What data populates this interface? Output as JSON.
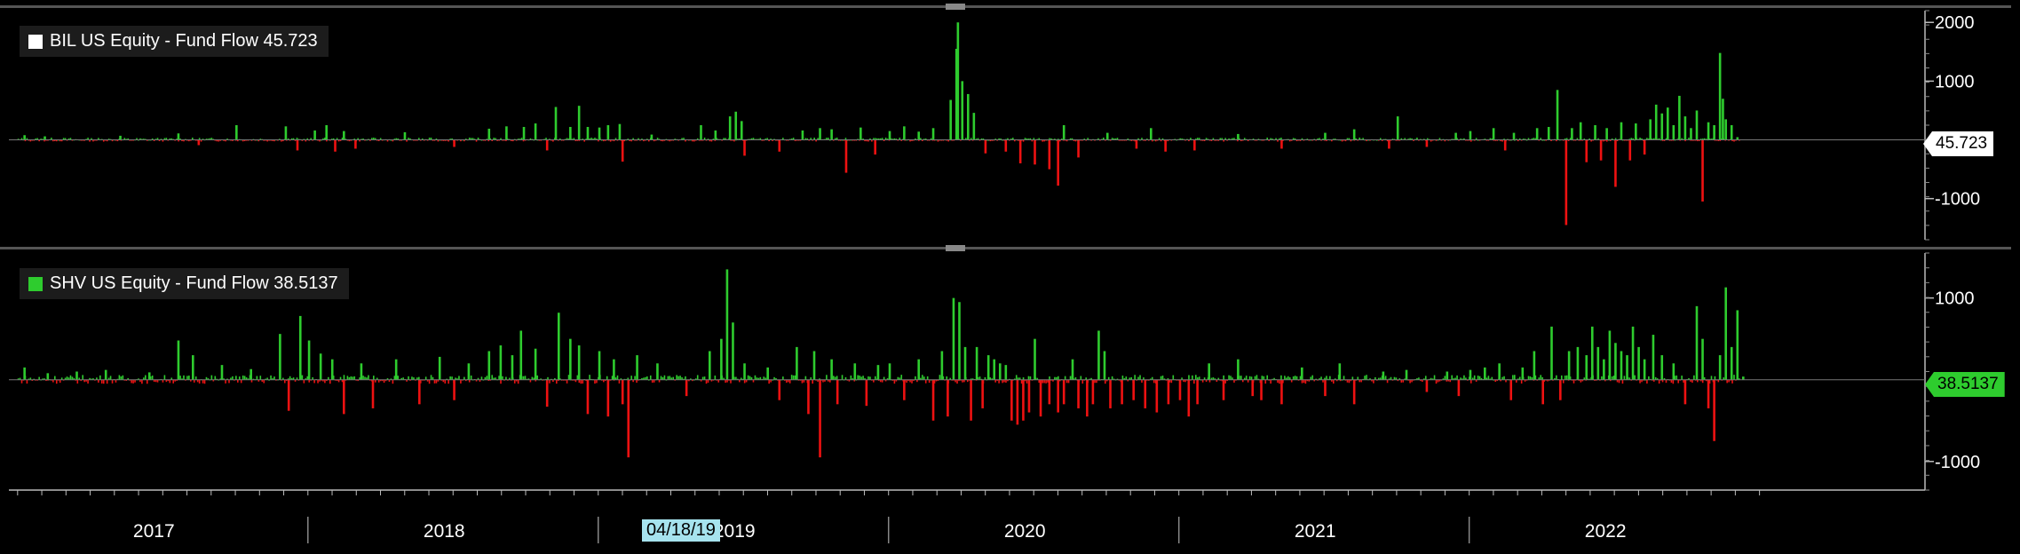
{
  "chart_data": [
    {
      "type": "bar",
      "name": "BIL",
      "legend": "BIL US Equity - Fund Flow 45.723",
      "legend_color": "#ffffff",
      "last_value": "45.723",
      "ylim": [
        -1700,
        2200
      ],
      "yticks": [
        2000,
        1000,
        -1000
      ],
      "pos_color": "#2ecc2e",
      "neg_color": "#ee1111",
      "spikes": [
        {
          "date": 2017.02,
          "value": 80
        },
        {
          "date": 2017.09,
          "value": 60
        },
        {
          "date": 2017.35,
          "value": 70
        },
        {
          "date": 2017.55,
          "value": 110
        },
        {
          "date": 2017.62,
          "value": -90
        },
        {
          "date": 2017.75,
          "value": 250
        },
        {
          "date": 2017.92,
          "value": 230
        },
        {
          "date": 2017.96,
          "value": -180
        },
        {
          "date": 2018.02,
          "value": 160
        },
        {
          "date": 2018.06,
          "value": 250
        },
        {
          "date": 2018.09,
          "value": -200
        },
        {
          "date": 2018.12,
          "value": 150
        },
        {
          "date": 2018.16,
          "value": -150
        },
        {
          "date": 2018.33,
          "value": 130
        },
        {
          "date": 2018.5,
          "value": -120
        },
        {
          "date": 2018.62,
          "value": 190
        },
        {
          "date": 2018.68,
          "value": 230
        },
        {
          "date": 2018.74,
          "value": 220
        },
        {
          "date": 2018.78,
          "value": 280
        },
        {
          "date": 2018.82,
          "value": -180
        },
        {
          "date": 2018.85,
          "value": 560
        },
        {
          "date": 2018.9,
          "value": 220
        },
        {
          "date": 2018.93,
          "value": 580
        },
        {
          "date": 2018.96,
          "value": 220
        },
        {
          "date": 2019.0,
          "value": 210
        },
        {
          "date": 2019.03,
          "value": 250
        },
        {
          "date": 2019.07,
          "value": 270
        },
        {
          "date": 2019.08,
          "value": -370
        },
        {
          "date": 2019.18,
          "value": 90
        },
        {
          "date": 2019.35,
          "value": 250
        },
        {
          "date": 2019.4,
          "value": 160
        },
        {
          "date": 2019.45,
          "value": 400
        },
        {
          "date": 2019.47,
          "value": 480
        },
        {
          "date": 2019.49,
          "value": 320
        },
        {
          "date": 2019.5,
          "value": -270
        },
        {
          "date": 2019.62,
          "value": -200
        },
        {
          "date": 2019.7,
          "value": 160
        },
        {
          "date": 2019.76,
          "value": 200
        },
        {
          "date": 2019.8,
          "value": 180
        },
        {
          "date": 2019.85,
          "value": -560
        },
        {
          "date": 2019.9,
          "value": 210
        },
        {
          "date": 2019.95,
          "value": -250
        },
        {
          "date": 2020.0,
          "value": 150
        },
        {
          "date": 2020.05,
          "value": 230
        },
        {
          "date": 2020.1,
          "value": 140
        },
        {
          "date": 2020.15,
          "value": 200
        },
        {
          "date": 2020.21,
          "value": 680
        },
        {
          "date": 2020.23,
          "value": 1550
        },
        {
          "date": 2020.235,
          "value": 2000
        },
        {
          "date": 2020.25,
          "value": 1000
        },
        {
          "date": 2020.27,
          "value": 780
        },
        {
          "date": 2020.29,
          "value": 460
        },
        {
          "date": 2020.33,
          "value": -230
        },
        {
          "date": 2020.4,
          "value": -200
        },
        {
          "date": 2020.45,
          "value": -400
        },
        {
          "date": 2020.5,
          "value": -420
        },
        {
          "date": 2020.55,
          "value": -500
        },
        {
          "date": 2020.58,
          "value": -780
        },
        {
          "date": 2020.6,
          "value": 250
        },
        {
          "date": 2020.65,
          "value": -300
        },
        {
          "date": 2020.75,
          "value": 120
        },
        {
          "date": 2020.85,
          "value": -150
        },
        {
          "date": 2020.9,
          "value": 200
        },
        {
          "date": 2020.95,
          "value": -200
        },
        {
          "date": 2021.05,
          "value": -180
        },
        {
          "date": 2021.2,
          "value": 100
        },
        {
          "date": 2021.35,
          "value": -150
        },
        {
          "date": 2021.5,
          "value": 120
        },
        {
          "date": 2021.6,
          "value": 180
        },
        {
          "date": 2021.72,
          "value": -150
        },
        {
          "date": 2021.75,
          "value": 400
        },
        {
          "date": 2021.85,
          "value": -120
        },
        {
          "date": 2021.95,
          "value": 120
        },
        {
          "date": 2022.0,
          "value": 150
        },
        {
          "date": 2022.08,
          "value": 200
        },
        {
          "date": 2022.12,
          "value": -180
        },
        {
          "date": 2022.15,
          "value": 120
        },
        {
          "date": 2022.23,
          "value": 200
        },
        {
          "date": 2022.27,
          "value": 220
        },
        {
          "date": 2022.3,
          "value": 850
        },
        {
          "date": 2022.33,
          "value": -1450
        },
        {
          "date": 2022.35,
          "value": 200
        },
        {
          "date": 2022.38,
          "value": 300
        },
        {
          "date": 2022.4,
          "value": -380
        },
        {
          "date": 2022.43,
          "value": 250
        },
        {
          "date": 2022.45,
          "value": -350
        },
        {
          "date": 2022.47,
          "value": 200
        },
        {
          "date": 2022.5,
          "value": -800
        },
        {
          "date": 2022.52,
          "value": 300
        },
        {
          "date": 2022.55,
          "value": -350
        },
        {
          "date": 2022.57,
          "value": 280
        },
        {
          "date": 2022.6,
          "value": -250
        },
        {
          "date": 2022.62,
          "value": 350
        },
        {
          "date": 2022.64,
          "value": 600
        },
        {
          "date": 2022.66,
          "value": 450
        },
        {
          "date": 2022.68,
          "value": 550
        },
        {
          "date": 2022.7,
          "value": 250
        },
        {
          "date": 2022.72,
          "value": 750
        },
        {
          "date": 2022.74,
          "value": 400
        },
        {
          "date": 2022.76,
          "value": 200
        },
        {
          "date": 2022.78,
          "value": 500
        },
        {
          "date": 2022.8,
          "value": -1050
        },
        {
          "date": 2022.82,
          "value": 300
        },
        {
          "date": 2022.84,
          "value": 250
        },
        {
          "date": 2022.86,
          "value": 1480
        },
        {
          "date": 2022.87,
          "value": 700
        },
        {
          "date": 2022.88,
          "value": 350
        },
        {
          "date": 2022.9,
          "value": 250
        },
        {
          "date": 2022.92,
          "value": 46
        }
      ]
    },
    {
      "type": "bar",
      "name": "SHV",
      "legend": "SHV US Equity - Fund Flow 38.5137",
      "legend_color": "#2ecc2e",
      "last_value": "38.5137",
      "ylim": [
        -1350,
        1550
      ],
      "yticks": [
        1000,
        -1000
      ],
      "pos_color": "#2ecc2e",
      "neg_color": "#ee1111",
      "spikes": [
        {
          "date": 2017.02,
          "value": 150
        },
        {
          "date": 2017.1,
          "value": 80
        },
        {
          "date": 2017.2,
          "value": 100
        },
        {
          "date": 2017.3,
          "value": 120
        },
        {
          "date": 2017.45,
          "value": 90
        },
        {
          "date": 2017.55,
          "value": 480
        },
        {
          "date": 2017.6,
          "value": 300
        },
        {
          "date": 2017.7,
          "value": 180
        },
        {
          "date": 2017.8,
          "value": 130
        },
        {
          "date": 2017.9,
          "value": 560
        },
        {
          "date": 2017.93,
          "value": -380
        },
        {
          "date": 2017.97,
          "value": 780
        },
        {
          "date": 2018.0,
          "value": 480
        },
        {
          "date": 2018.04,
          "value": 320
        },
        {
          "date": 2018.08,
          "value": 250
        },
        {
          "date": 2018.12,
          "value": -420
        },
        {
          "date": 2018.18,
          "value": 200
        },
        {
          "date": 2018.22,
          "value": -350
        },
        {
          "date": 2018.3,
          "value": 250
        },
        {
          "date": 2018.38,
          "value": -300
        },
        {
          "date": 2018.45,
          "value": 280
        },
        {
          "date": 2018.5,
          "value": -250
        },
        {
          "date": 2018.55,
          "value": 200
        },
        {
          "date": 2018.62,
          "value": 350
        },
        {
          "date": 2018.66,
          "value": 420
        },
        {
          "date": 2018.7,
          "value": 300
        },
        {
          "date": 2018.73,
          "value": 600
        },
        {
          "date": 2018.78,
          "value": 380
        },
        {
          "date": 2018.82,
          "value": -330
        },
        {
          "date": 2018.86,
          "value": 820
        },
        {
          "date": 2018.9,
          "value": 500
        },
        {
          "date": 2018.93,
          "value": 420
        },
        {
          "date": 2018.96,
          "value": -420
        },
        {
          "date": 2019.0,
          "value": 350
        },
        {
          "date": 2019.03,
          "value": -450
        },
        {
          "date": 2019.05,
          "value": 250
        },
        {
          "date": 2019.08,
          "value": -300
        },
        {
          "date": 2019.1,
          "value": -950
        },
        {
          "date": 2019.13,
          "value": 300
        },
        {
          "date": 2019.2,
          "value": 200
        },
        {
          "date": 2019.3,
          "value": -200
        },
        {
          "date": 2019.38,
          "value": 350
        },
        {
          "date": 2019.42,
          "value": 500
        },
        {
          "date": 2019.44,
          "value": 1350
        },
        {
          "date": 2019.46,
          "value": 700
        },
        {
          "date": 2019.5,
          "value": 200
        },
        {
          "date": 2019.58,
          "value": 150
        },
        {
          "date": 2019.62,
          "value": -250
        },
        {
          "date": 2019.68,
          "value": 400
        },
        {
          "date": 2019.72,
          "value": -420
        },
        {
          "date": 2019.74,
          "value": 350
        },
        {
          "date": 2019.76,
          "value": -950
        },
        {
          "date": 2019.8,
          "value": 250
        },
        {
          "date": 2019.82,
          "value": -300
        },
        {
          "date": 2019.88,
          "value": 200
        },
        {
          "date": 2019.92,
          "value": -320
        },
        {
          "date": 2019.96,
          "value": 180
        },
        {
          "date": 2020.0,
          "value": 200
        },
        {
          "date": 2020.05,
          "value": -250
        },
        {
          "date": 2020.1,
          "value": 250
        },
        {
          "date": 2020.15,
          "value": -500
        },
        {
          "date": 2020.18,
          "value": 350
        },
        {
          "date": 2020.2,
          "value": -450
        },
        {
          "date": 2020.22,
          "value": 1000
        },
        {
          "date": 2020.24,
          "value": 950
        },
        {
          "date": 2020.26,
          "value": 400
        },
        {
          "date": 2020.28,
          "value": -500
        },
        {
          "date": 2020.3,
          "value": 400
        },
        {
          "date": 2020.32,
          "value": -350
        },
        {
          "date": 2020.34,
          "value": 300
        },
        {
          "date": 2020.36,
          "value": 250
        },
        {
          "date": 2020.38,
          "value": 200
        },
        {
          "date": 2020.4,
          "value": 180
        },
        {
          "date": 2020.42,
          "value": -500
        },
        {
          "date": 2020.44,
          "value": -550
        },
        {
          "date": 2020.46,
          "value": -500
        },
        {
          "date": 2020.48,
          "value": -400
        },
        {
          "date": 2020.5,
          "value": 500
        },
        {
          "date": 2020.52,
          "value": -450
        },
        {
          "date": 2020.55,
          "value": -300
        },
        {
          "date": 2020.58,
          "value": -400
        },
        {
          "date": 2020.6,
          "value": -300
        },
        {
          "date": 2020.63,
          "value": 250
        },
        {
          "date": 2020.65,
          "value": -350
        },
        {
          "date": 2020.68,
          "value": -450
        },
        {
          "date": 2020.7,
          "value": -300
        },
        {
          "date": 2020.72,
          "value": 600
        },
        {
          "date": 2020.74,
          "value": 350
        },
        {
          "date": 2020.76,
          "value": -350
        },
        {
          "date": 2020.8,
          "value": -300
        },
        {
          "date": 2020.84,
          "value": -250
        },
        {
          "date": 2020.88,
          "value": -350
        },
        {
          "date": 2020.92,
          "value": -400
        },
        {
          "date": 2020.96,
          "value": -300
        },
        {
          "date": 2021.0,
          "value": -250
        },
        {
          "date": 2021.03,
          "value": -450
        },
        {
          "date": 2021.06,
          "value": -300
        },
        {
          "date": 2021.1,
          "value": 200
        },
        {
          "date": 2021.15,
          "value": -250
        },
        {
          "date": 2021.2,
          "value": 250
        },
        {
          "date": 2021.25,
          "value": -200
        },
        {
          "date": 2021.28,
          "value": -250
        },
        {
          "date": 2021.35,
          "value": -300
        },
        {
          "date": 2021.42,
          "value": 150
        },
        {
          "date": 2021.5,
          "value": -200
        },
        {
          "date": 2021.55,
          "value": 200
        },
        {
          "date": 2021.6,
          "value": -300
        },
        {
          "date": 2021.7,
          "value": 100
        },
        {
          "date": 2021.78,
          "value": 120
        },
        {
          "date": 2021.85,
          "value": -150
        },
        {
          "date": 2021.92,
          "value": 100
        },
        {
          "date": 2021.96,
          "value": -200
        },
        {
          "date": 2022.0,
          "value": 120
        },
        {
          "date": 2022.05,
          "value": 150
        },
        {
          "date": 2022.1,
          "value": 200
        },
        {
          "date": 2022.14,
          "value": -250
        },
        {
          "date": 2022.18,
          "value": 150
        },
        {
          "date": 2022.22,
          "value": 350
        },
        {
          "date": 2022.25,
          "value": -300
        },
        {
          "date": 2022.28,
          "value": 650
        },
        {
          "date": 2022.31,
          "value": -250
        },
        {
          "date": 2022.34,
          "value": 350
        },
        {
          "date": 2022.37,
          "value": 400
        },
        {
          "date": 2022.4,
          "value": 300
        },
        {
          "date": 2022.42,
          "value": 650
        },
        {
          "date": 2022.44,
          "value": 400
        },
        {
          "date": 2022.46,
          "value": 250
        },
        {
          "date": 2022.48,
          "value": 600
        },
        {
          "date": 2022.5,
          "value": 450
        },
        {
          "date": 2022.52,
          "value": 350
        },
        {
          "date": 2022.54,
          "value": 300
        },
        {
          "date": 2022.56,
          "value": 650
        },
        {
          "date": 2022.58,
          "value": 400
        },
        {
          "date": 2022.6,
          "value": 250
        },
        {
          "date": 2022.63,
          "value": 550
        },
        {
          "date": 2022.66,
          "value": 300
        },
        {
          "date": 2022.7,
          "value": 200
        },
        {
          "date": 2022.74,
          "value": -300
        },
        {
          "date": 2022.78,
          "value": 900
        },
        {
          "date": 2022.8,
          "value": 500
        },
        {
          "date": 2022.82,
          "value": -350
        },
        {
          "date": 2022.84,
          "value": -750
        },
        {
          "date": 2022.86,
          "value": 300
        },
        {
          "date": 2022.88,
          "value": 1130
        },
        {
          "date": 2022.9,
          "value": 400
        },
        {
          "date": 2022.92,
          "value": 850
        },
        {
          "date": 2022.94,
          "value": 38.5
        }
      ]
    }
  ],
  "x_axis": {
    "years": [
      "2017",
      "2018",
      "2019",
      "2020",
      "2021",
      "2022"
    ],
    "year_starts": [
      2017,
      2018,
      2019,
      2020,
      2021,
      2022,
      2023
    ],
    "range": [
      2016.97,
      2023.57
    ],
    "highlight_date": "04/18/19"
  }
}
